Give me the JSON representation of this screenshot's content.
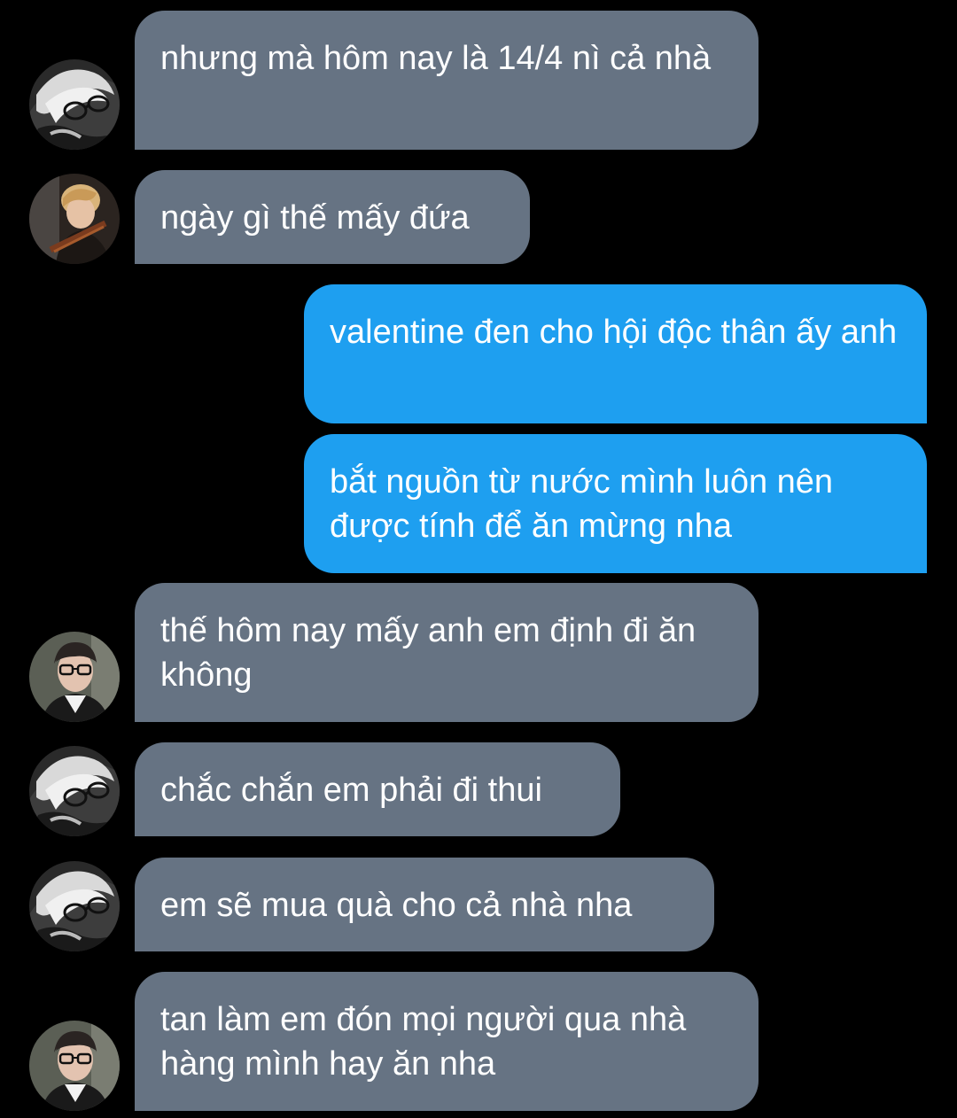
{
  "messages": [
    {
      "sender": "incoming",
      "avatar": "person-bw-glasses-avatar",
      "text": "nhưng mà hôm nay là 14/4 nì cả nhà"
    },
    {
      "sender": "incoming",
      "avatar": "person-blonde-violin-avatar",
      "text": "ngày gì thế mấy đứa"
    },
    {
      "sender": "outgoing",
      "text": "valentine đen cho hội độc thân ấy anh"
    },
    {
      "sender": "outgoing",
      "text": "bắt nguồn từ nước mình luôn nên được tính để ăn mừng nha"
    },
    {
      "sender": "incoming",
      "avatar": "person-glasses-avatar",
      "text": "thế hôm nay mấy anh em định đi ăn không"
    },
    {
      "sender": "incoming",
      "avatar": "person-bw-glasses-avatar",
      "text": "chắc chắn em phải đi thui"
    },
    {
      "sender": "incoming",
      "avatar": "person-bw-glasses-avatar",
      "text": "em sẽ mua quà cho cả nhà nha"
    },
    {
      "sender": "incoming",
      "avatar": "person-glasses-avatar",
      "text": "tan làm em đón mọi người qua nhà hàng mình hay ăn nha"
    }
  ],
  "colors": {
    "background": "#000000",
    "incoming_bubble": "#667383",
    "outgoing_bubble": "#1e9ff0",
    "text": "#ffffff"
  }
}
